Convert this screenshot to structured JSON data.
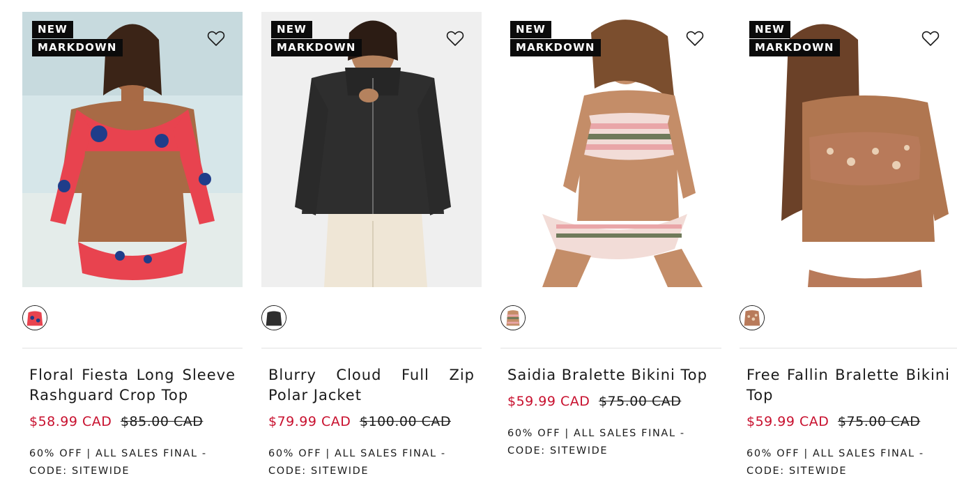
{
  "products": [
    {
      "badges": [
        "NEW",
        "MARKDOWN"
      ],
      "image_icon": "model-floral-rashguard",
      "swatch_icon": "floral-swatch",
      "title": "Floral Fiesta Long Sleeve Rashguard Crop Top",
      "sale_price": "$58.99 CAD",
      "original_price": "$85.00 CAD",
      "promo": "60% OFF | ALL SALES FINAL - CODE: SITEWIDE",
      "colors": {
        "bg": "#cfe0e4",
        "accent": "#e8434f",
        "accent2": "#1f3d8a"
      }
    },
    {
      "badges": [
        "NEW",
        "MARKDOWN"
      ],
      "image_icon": "model-black-fleece-jacket",
      "swatch_icon": "black-swatch",
      "title": "Blurry Cloud Full Zip Polar Jacket",
      "sale_price": "$79.99 CAD",
      "original_price": "$100.00 CAD",
      "promo": "60% OFF | ALL SALES FINAL - CODE: SITEWIDE",
      "colors": {
        "bg": "#efefef",
        "accent": "#2e2e2e",
        "accent2": "#efe6d6"
      }
    },
    {
      "badges": [
        "NEW",
        "MARKDOWN"
      ],
      "image_icon": "model-striped-bikini",
      "swatch_icon": "striped-swatch",
      "title": "Saidia Bralette Bikini Top",
      "sale_price": "$59.99 CAD",
      "original_price": "$75.00 CAD",
      "promo": "60% OFF | ALL SALES FINAL - CODE: SITEWIDE",
      "colors": {
        "bg": "#ffffff",
        "accent": "#e9a6a8",
        "accent2": "#6f7a5a"
      }
    },
    {
      "badges": [
        "NEW",
        "MARKDOWN"
      ],
      "image_icon": "model-leopard-bikini",
      "swatch_icon": "leopard-swatch",
      "title": "Free Fallin Bralette Bikini Top",
      "sale_price": "$59.99 CAD",
      "original_price": "$75.00 CAD",
      "promo": "60% OFF | ALL SALES FINAL - CODE: SITEWIDE",
      "colors": {
        "bg": "#ffffff",
        "accent": "#b87a5a",
        "accent2": "#e9cfb4"
      }
    }
  ],
  "wishlist_icon": "heart-outline-icon",
  "colors": {
    "sale": "#c8102e",
    "badge_bg": "#0b0b0b",
    "text": "#1a1a1a"
  }
}
